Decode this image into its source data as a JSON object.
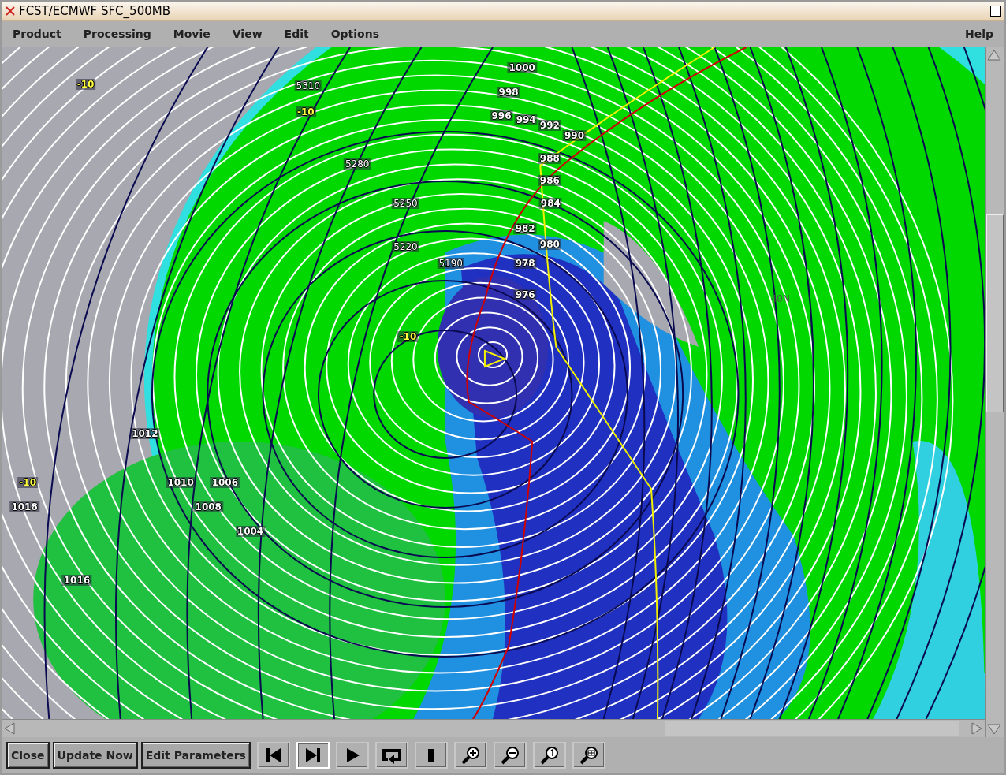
{
  "window": {
    "title": "FCST/ECMWF SFC_500MB"
  },
  "menu": [
    {
      "label": "Product"
    },
    {
      "label": "Processing"
    },
    {
      "label": "Movie"
    },
    {
      "label": "View"
    },
    {
      "label": "Edit"
    },
    {
      "label": "Options"
    }
  ],
  "help_menu": {
    "label": "Help"
  },
  "map": {
    "labels": [
      {
        "text": "1000",
        "kind": "pressure"
      },
      {
        "text": "998",
        "kind": "pressure"
      },
      {
        "text": "996",
        "kind": "pressure"
      },
      {
        "text": "994",
        "kind": "pressure"
      },
      {
        "text": "992",
        "kind": "pressure"
      },
      {
        "text": "990",
        "kind": "pressure"
      },
      {
        "text": "988",
        "kind": "pressure"
      },
      {
        "text": "986",
        "kind": "pressure"
      },
      {
        "text": "984",
        "kind": "pressure"
      },
      {
        "text": "982",
        "kind": "pressure"
      },
      {
        "text": "980",
        "kind": "pressure"
      },
      {
        "text": "978",
        "kind": "pressure"
      },
      {
        "text": "976",
        "kind": "pressure"
      },
      {
        "text": "1012",
        "kind": "pressure"
      },
      {
        "text": "1010",
        "kind": "pressure"
      },
      {
        "text": "1006",
        "kind": "pressure"
      },
      {
        "text": "1008",
        "kind": "pressure"
      },
      {
        "text": "1004",
        "kind": "pressure"
      },
      {
        "text": "1018",
        "kind": "pressure"
      },
      {
        "text": "1016",
        "kind": "pressure"
      },
      {
        "text": "5310",
        "kind": "height"
      },
      {
        "text": "5280",
        "kind": "height"
      },
      {
        "text": "5250",
        "kind": "height"
      },
      {
        "text": "5220",
        "kind": "height"
      },
      {
        "text": "5190",
        "kind": "height"
      },
      {
        "text": "-10",
        "kind": "temperature"
      },
      {
        "text": "-10",
        "kind": "temperature"
      },
      {
        "text": "-10",
        "kind": "temperature"
      },
      {
        "text": "-10",
        "kind": "temperature"
      },
      {
        "text": "40N",
        "kind": "grid"
      }
    ]
  },
  "buttons": [
    {
      "label": "Close"
    },
    {
      "label": "Update Now"
    },
    {
      "label": "Edit Parameters"
    }
  ],
  "playback": [
    {
      "kind": "first",
      "selected": false
    },
    {
      "kind": "last",
      "selected": true
    },
    {
      "kind": "play",
      "selected": false
    },
    {
      "kind": "loop",
      "selected": false
    },
    {
      "kind": "stop",
      "selected": false
    },
    {
      "kind": "zoom-in",
      "selected": false
    },
    {
      "kind": "zoom-out",
      "selected": false
    },
    {
      "kind": "zoom-reset",
      "selected": false
    },
    {
      "kind": "zoom-fit",
      "selected": false
    }
  ]
}
